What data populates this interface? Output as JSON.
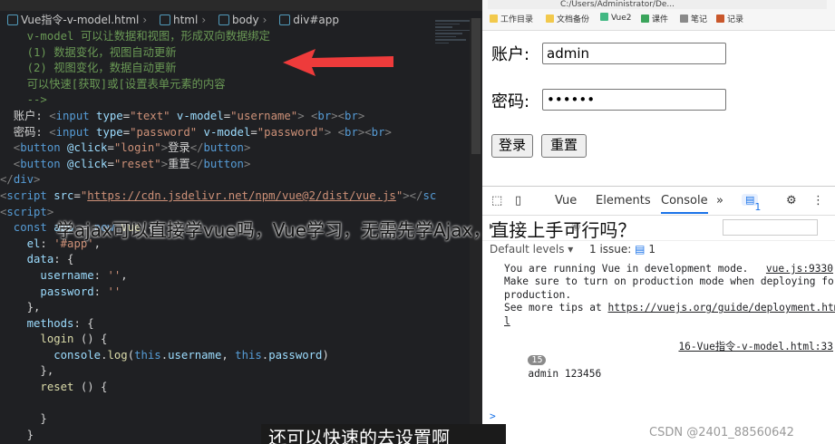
{
  "editor": {
    "file_tab": "vue指令-v-model.html",
    "breadcrumbs": [
      "Vue指令-v-model.html",
      "html",
      "body",
      "div#app"
    ],
    "code_lines": [
      {
        "spans": [
          [
            "c",
            "    v-model 可以让数据和视图，形成双向数据绑定"
          ]
        ]
      },
      {
        "spans": [
          [
            "c",
            "    (1) 数据变化，视图自动更新"
          ]
        ]
      },
      {
        "spans": [
          [
            "c",
            "    (2) 视图变化，数据自动更新"
          ]
        ]
      },
      {
        "spans": [
          [
            "c",
            "    可以快速[获取]或[设置表单元素的内容"
          ]
        ]
      },
      {
        "spans": [
          [
            "c",
            "    -->"
          ]
        ]
      },
      {
        "spans": [
          [
            "tx",
            "  账户: "
          ],
          [
            "p",
            "<"
          ],
          [
            "t",
            "input"
          ],
          [
            "a",
            " type"
          ],
          [
            "tx",
            "="
          ],
          [
            "s",
            "\"text\""
          ],
          [
            "a",
            " v-model"
          ],
          [
            "tx",
            "="
          ],
          [
            "s",
            "\"username\""
          ],
          [
            "p",
            ">"
          ],
          [
            "tx",
            " "
          ],
          [
            "p",
            "<"
          ],
          [
            "t",
            "br"
          ],
          [
            "p",
            "><"
          ],
          [
            "t",
            "br"
          ],
          [
            "p",
            ">"
          ]
        ]
      },
      {
        "spans": [
          [
            "tx",
            "  密码: "
          ],
          [
            "p",
            "<"
          ],
          [
            "t",
            "input"
          ],
          [
            "a",
            " type"
          ],
          [
            "tx",
            "="
          ],
          [
            "s",
            "\"password\""
          ],
          [
            "a",
            " v-model"
          ],
          [
            "tx",
            "="
          ],
          [
            "s",
            "\"password\""
          ],
          [
            "p",
            ">"
          ],
          [
            "tx",
            " "
          ],
          [
            "p",
            "<"
          ],
          [
            "t",
            "br"
          ],
          [
            "p",
            "><"
          ],
          [
            "t",
            "br"
          ],
          [
            "p",
            ">"
          ]
        ]
      },
      {
        "spans": [
          [
            "p",
            "  <"
          ],
          [
            "t",
            "button"
          ],
          [
            "a",
            " @click"
          ],
          [
            "tx",
            "="
          ],
          [
            "s",
            "\"login\""
          ],
          [
            "p",
            ">"
          ],
          [
            "tx",
            "登录"
          ],
          [
            "p",
            "</"
          ],
          [
            "t",
            "button"
          ],
          [
            "p",
            ">"
          ]
        ]
      },
      {
        "spans": [
          [
            "p",
            "  <"
          ],
          [
            "t",
            "button"
          ],
          [
            "a",
            " @click"
          ],
          [
            "tx",
            "="
          ],
          [
            "s",
            "\"reset\""
          ],
          [
            "p",
            ">"
          ],
          [
            "tx",
            "重置"
          ],
          [
            "p",
            "</"
          ],
          [
            "t",
            "button"
          ],
          [
            "p",
            ">"
          ]
        ]
      },
      {
        "spans": [
          [
            "p",
            "</"
          ],
          [
            "t",
            "div"
          ],
          [
            "p",
            ">"
          ]
        ]
      },
      {
        "spans": [
          [
            "p",
            "<"
          ],
          [
            "t",
            "script"
          ],
          [
            "a",
            " src"
          ],
          [
            "tx",
            "="
          ],
          [
            "s",
            "\""
          ],
          [
            "u",
            "https://cdn.jsdelivr.net/npm/vue@2/dist/vue.js"
          ],
          [
            "s",
            "\""
          ],
          [
            "p",
            "></"
          ],
          [
            "t",
            "sc"
          ]
        ]
      },
      {
        "spans": [
          [
            "p",
            "<"
          ],
          [
            "t",
            "script"
          ],
          [
            "p",
            ">"
          ]
        ]
      },
      {
        "spans": [
          [
            "kw",
            "  const"
          ],
          [
            "a",
            " app"
          ],
          [
            "tx",
            " = "
          ],
          [
            "kw",
            "new"
          ],
          [
            "y",
            " Vue"
          ],
          [
            "tx",
            "({"
          ]
        ]
      },
      {
        "spans": [
          [
            "a",
            "    el"
          ],
          [
            "tx",
            ": "
          ],
          [
            "s",
            "'#app'"
          ],
          [
            "tx",
            ","
          ]
        ]
      },
      {
        "spans": [
          [
            "a",
            "    data"
          ],
          [
            "tx",
            ": {"
          ]
        ]
      },
      {
        "spans": [
          [
            "a",
            "      username"
          ],
          [
            "tx",
            ": "
          ],
          [
            "s",
            "''"
          ],
          [
            "tx",
            ","
          ]
        ]
      },
      {
        "spans": [
          [
            "a",
            "      password"
          ],
          [
            "tx",
            ": "
          ],
          [
            "s",
            "''"
          ]
        ]
      },
      {
        "spans": [
          [
            "tx",
            "    },"
          ]
        ]
      },
      {
        "spans": [
          [
            "a",
            "    methods"
          ],
          [
            "tx",
            ": {"
          ]
        ]
      },
      {
        "spans": [
          [
            "y",
            "      login"
          ],
          [
            "tx",
            " () {"
          ]
        ]
      },
      {
        "spans": [
          [
            "a",
            "        console"
          ],
          [
            "tx",
            "."
          ],
          [
            "y",
            "log"
          ],
          [
            "tx",
            "("
          ],
          [
            "kw",
            "this"
          ],
          [
            "tx",
            "."
          ],
          [
            "a",
            "username"
          ],
          [
            "tx",
            ", "
          ],
          [
            "kw",
            "this"
          ],
          [
            "tx",
            "."
          ],
          [
            "a",
            "password"
          ],
          [
            "tx",
            ")"
          ]
        ]
      },
      {
        "spans": [
          [
            "tx",
            "      },"
          ]
        ]
      },
      {
        "spans": [
          [
            "y",
            "      reset"
          ],
          [
            "tx",
            " () {"
          ]
        ]
      },
      {
        "spans": [
          [
            "tx",
            " "
          ]
        ]
      },
      {
        "spans": [
          [
            "tx",
            "      }"
          ]
        ]
      },
      {
        "spans": [
          [
            "tx",
            "    }"
          ]
        ]
      }
    ]
  },
  "browser": {
    "url": "C:/Users/Administrator/De...",
    "bookmarks": [
      "工作目录",
      "文档备份",
      "Vue2",
      "课件",
      "笔记",
      "记录"
    ],
    "account_label": "账户:",
    "account_value": "admin",
    "password_label": "密码:",
    "password_value": "••••••",
    "login_label": "登录",
    "reset_label": "重置"
  },
  "devtools": {
    "tabs": [
      "Vue",
      "Elements",
      "Console"
    ],
    "more": "»",
    "issues_badge": "1",
    "filter_label": "Default levels",
    "issue_text": "1 issue:",
    "issue_count": "1",
    "console_lines": [
      {
        "text": "You are running Vue in development mode.",
        "src": "vue.js:9330"
      },
      {
        "text": "Make sure to turn on production mode when deploying for",
        "src": ""
      },
      {
        "text": "production.",
        "src": ""
      },
      {
        "text": "See more tips at ",
        "link": "https://vuejs.org/guide/deployment.htm",
        "src": ""
      },
      {
        "text": "l",
        "src": ""
      }
    ],
    "log_count": "15",
    "log_message": "admin 123456",
    "log_source": "16-Vue指令-v-model.html:33",
    "prompt": ">"
  },
  "overlay": {
    "title": "学ajax可以直接学vue吗，Vue学习，无需先学Ajax，直接上手可行吗？",
    "subtitle": "还可以快速的去设置啊",
    "watermark": "CSDN @2401_88560642"
  },
  "colors": {
    "arrow": "#ee3b3b",
    "editor_bg": "#1f2023",
    "accent": "#1a73e8"
  }
}
